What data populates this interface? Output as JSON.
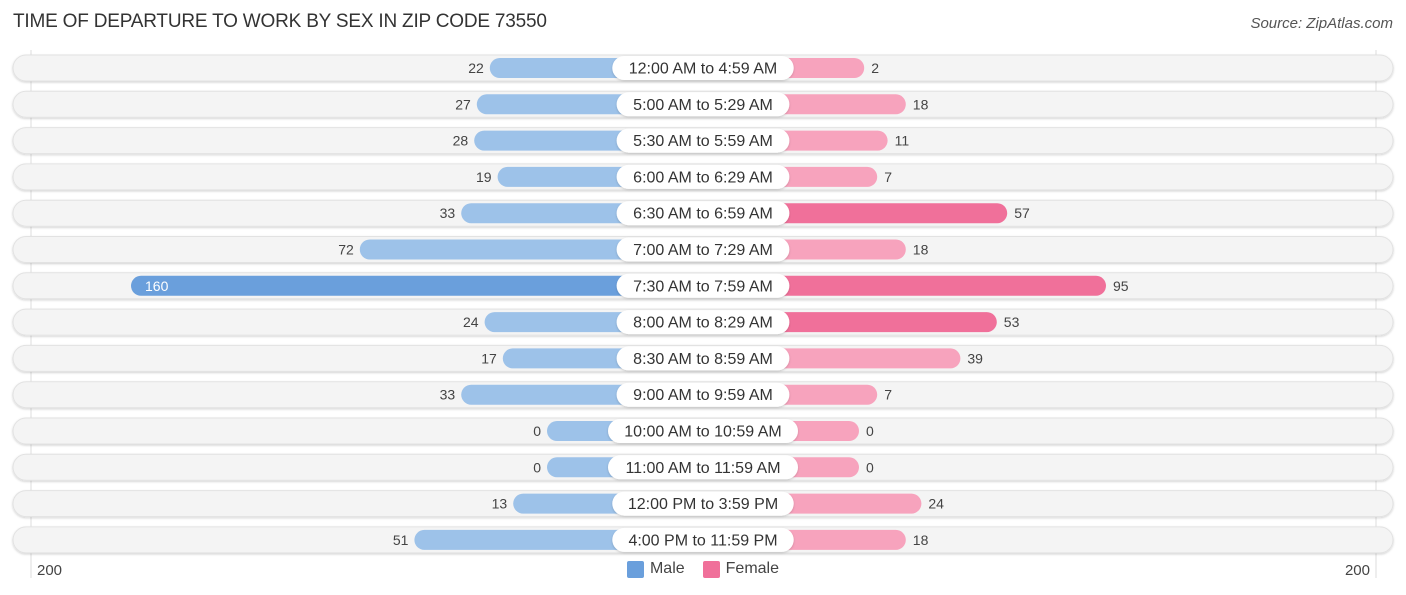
{
  "title": "TIME OF DEPARTURE TO WORK BY SEX IN ZIP CODE 73550",
  "source": "Source: ZipAtlas.com",
  "colors": {
    "male_light": "#9dc2e9",
    "male_strong": "#6a9fdc",
    "female_light": "#f7a3bd",
    "female_strong": "#f0709a",
    "row_bg": "#f3f3f3"
  },
  "chart_data": {
    "type": "bar",
    "orientation": "horizontal-diverging",
    "title": "TIME OF DEPARTURE TO WORK BY SEX IN ZIP CODE 73550",
    "categories": [
      "12:00 AM to 4:59 AM",
      "5:00 AM to 5:29 AM",
      "5:30 AM to 5:59 AM",
      "6:00 AM to 6:29 AM",
      "6:30 AM to 6:59 AM",
      "7:00 AM to 7:29 AM",
      "7:30 AM to 7:59 AM",
      "8:00 AM to 8:29 AM",
      "8:30 AM to 8:59 AM",
      "9:00 AM to 9:59 AM",
      "10:00 AM to 10:59 AM",
      "11:00 AM to 11:59 AM",
      "12:00 PM to 3:59 PM",
      "4:00 PM to 11:59 PM"
    ],
    "series": [
      {
        "name": "Male",
        "values": [
          22,
          27,
          28,
          19,
          33,
          72,
          160,
          24,
          17,
          33,
          0,
          0,
          13,
          51
        ]
      },
      {
        "name": "Female",
        "values": [
          2,
          18,
          11,
          7,
          57,
          18,
          95,
          53,
          39,
          7,
          0,
          0,
          24,
          18
        ]
      }
    ],
    "axis": {
      "left_label": "200",
      "right_label": "200",
      "range": [
        0,
        200
      ]
    },
    "legend": {
      "position": "bottom-center",
      "entries": [
        "Male",
        "Female"
      ]
    },
    "grid": false
  }
}
